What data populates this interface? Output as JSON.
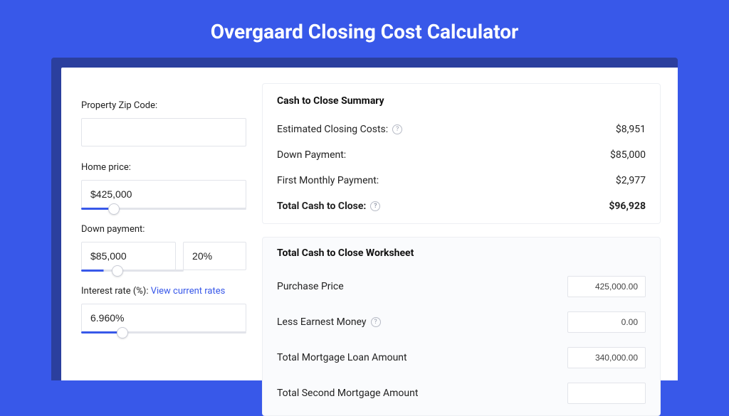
{
  "title": "Overgaard Closing Cost Calculator",
  "form": {
    "zip_label": "Property Zip Code:",
    "zip_value": "",
    "home_price_label": "Home price:",
    "home_price_value": "$425,000",
    "home_price_slider_pct": "20%",
    "down_payment_label": "Down payment:",
    "down_payment_value": "$85,000",
    "down_payment_pct_value": "20%",
    "down_payment_slider_pct": "22%",
    "rate_label_prefix": "Interest rate (%): ",
    "rate_link": "View current rates",
    "rate_value": "6.960%",
    "rate_slider_pct": "25%"
  },
  "summary": {
    "heading": "Cash to Close Summary",
    "rows": [
      {
        "label": "Estimated Closing Costs:",
        "help": true,
        "value": "$8,951",
        "bold": false
      },
      {
        "label": "Down Payment:",
        "help": false,
        "value": "$85,000",
        "bold": false
      },
      {
        "label": "First Monthly Payment:",
        "help": false,
        "value": "$2,977",
        "bold": false
      },
      {
        "label": "Total Cash to Close:",
        "help": true,
        "value": "$96,928",
        "bold": true
      }
    ]
  },
  "worksheet": {
    "heading": "Total Cash to Close Worksheet",
    "rows": [
      {
        "label": "Purchase Price",
        "help": false,
        "value": "425,000.00"
      },
      {
        "label": "Less Earnest Money",
        "help": true,
        "value": "0.00"
      },
      {
        "label": "Total Mortgage Loan Amount",
        "help": false,
        "value": "340,000.00"
      },
      {
        "label": "Total Second Mortgage Amount",
        "help": false,
        "value": ""
      }
    ]
  }
}
